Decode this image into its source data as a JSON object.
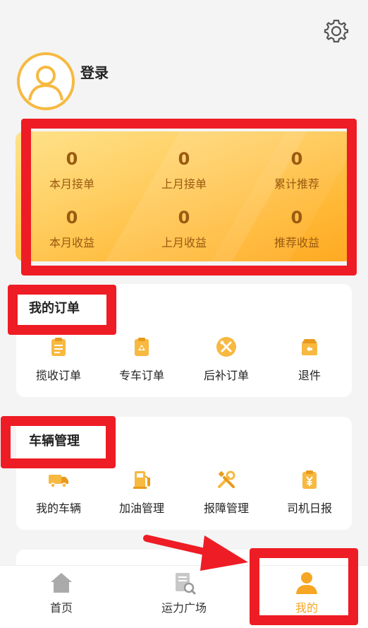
{
  "header": {
    "login_label": "登录",
    "settings_icon": "gear-icon",
    "avatar_icon": "user-avatar-icon"
  },
  "stats": [
    {
      "value": "0",
      "label": "本月接单"
    },
    {
      "value": "0",
      "label": "上月接单"
    },
    {
      "value": "0",
      "label": "累计推荐"
    },
    {
      "value": "0",
      "label": "本月收益"
    },
    {
      "value": "0",
      "label": "上月收益"
    },
    {
      "value": "0",
      "label": "推荐收益"
    }
  ],
  "orders": {
    "title": "我的订单",
    "items": [
      {
        "label": "揽收订单",
        "icon": "clipboard-icon"
      },
      {
        "label": "专车订单",
        "icon": "special-car-order-icon"
      },
      {
        "label": "后补订单",
        "icon": "tools-icon"
      },
      {
        "label": "退件",
        "icon": "return-box-icon"
      }
    ]
  },
  "vehicles": {
    "title": "车辆管理",
    "items": [
      {
        "label": "我的车辆",
        "icon": "truck-icon"
      },
      {
        "label": "加油管理",
        "icon": "fuel-pump-icon"
      },
      {
        "label": "报障管理",
        "icon": "wrench-screwdriver-icon"
      },
      {
        "label": "司机日报",
        "icon": "yuan-report-icon"
      }
    ]
  },
  "bottom_nav": {
    "items": [
      {
        "label": "首页",
        "icon": "home-icon"
      },
      {
        "label": "运力广场",
        "icon": "document-search-icon"
      },
      {
        "label": "我的",
        "icon": "person-icon"
      }
    ],
    "active": "我的"
  },
  "colors": {
    "accent": "#f6a623",
    "highlight": "#ee1c24",
    "stat_text": "#9a5a10"
  }
}
